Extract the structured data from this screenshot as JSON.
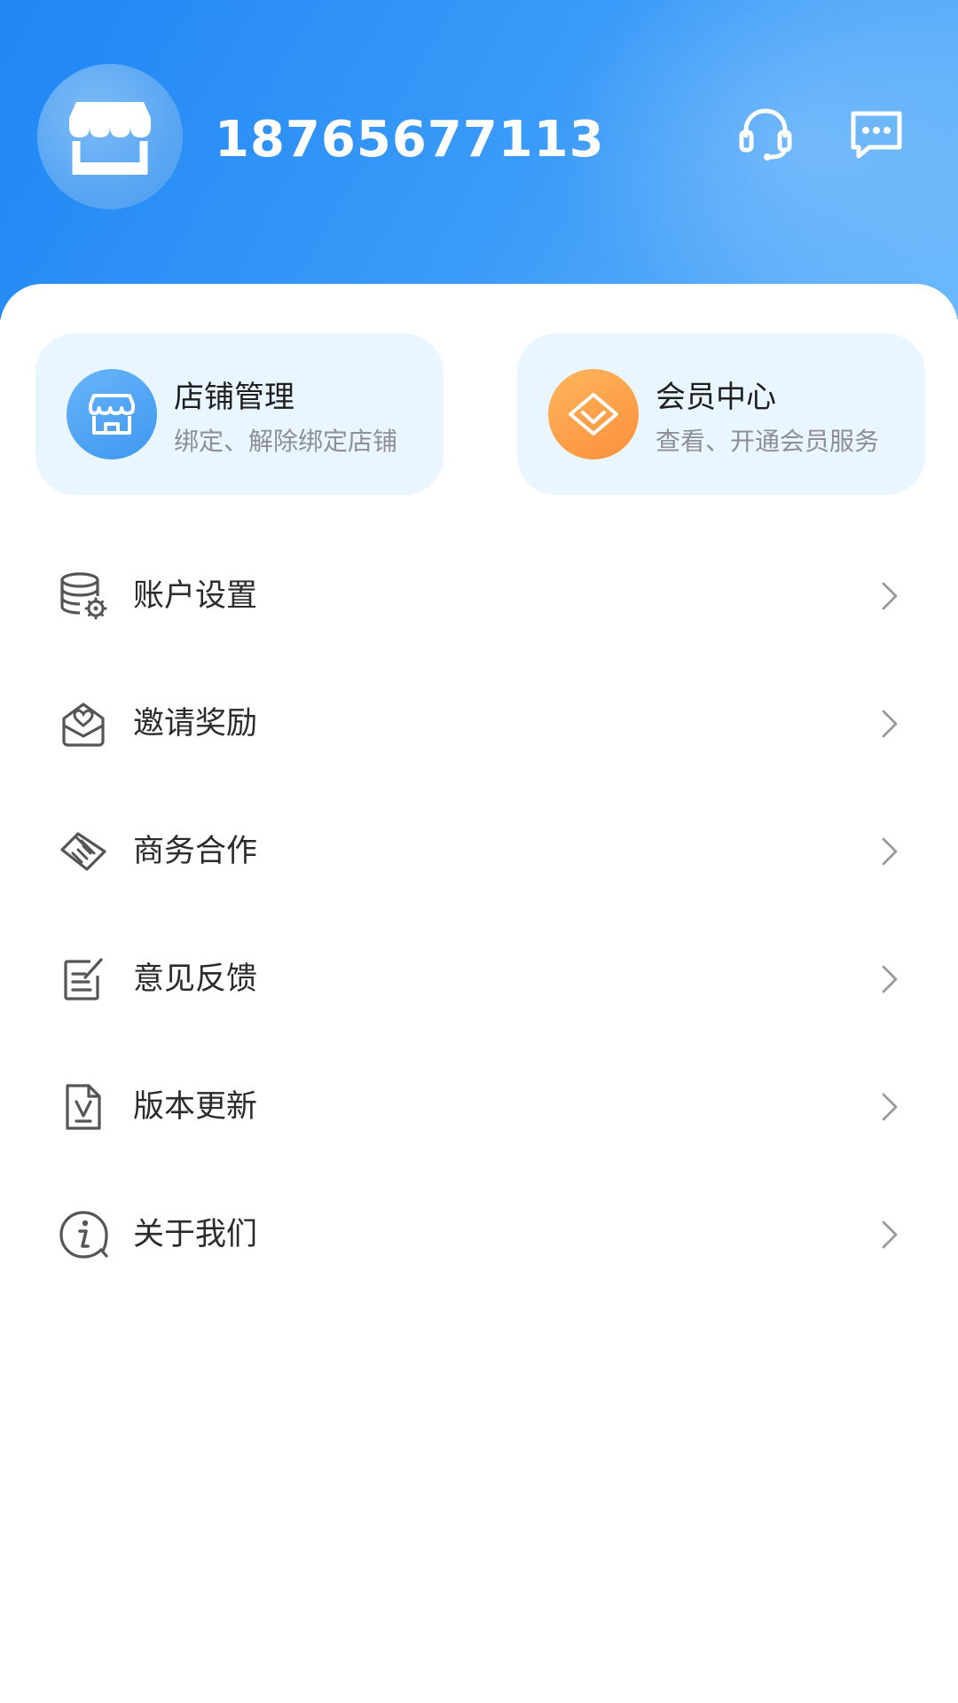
{
  "header": {
    "phone": "18765677113",
    "avatar_icon": "store-icon",
    "service_icon": "headset-icon",
    "message_icon": "chat-bubble-icon",
    "gradient_start": "#1f86f4",
    "gradient_end": "#6bb8fb"
  },
  "cards": [
    {
      "title": "店铺管理",
      "subtitle": "绑定、解除绑定店铺",
      "icon": "store-icon",
      "icon_color": "#4a9ff2"
    },
    {
      "title": "会员中心",
      "subtitle": "查看、开通会员服务",
      "icon": "diamond-icon",
      "icon_color": "#fb9a45"
    }
  ],
  "menu": {
    "items": [
      {
        "label": "账户设置",
        "icon": "database-gear-icon"
      },
      {
        "label": "邀请奖励",
        "icon": "gift-envelope-icon"
      },
      {
        "label": "商务合作",
        "icon": "handshake-icon"
      },
      {
        "label": "意见反馈",
        "icon": "edit-note-icon"
      },
      {
        "label": "版本更新",
        "icon": "version-file-icon"
      },
      {
        "label": "关于我们",
        "icon": "info-icon"
      }
    ]
  },
  "colors": {
    "card_bg": "#eaf6ff",
    "text_primary": "#2b2b2b",
    "text_secondary": "#8d8f93",
    "chevron": "#9a9a9a"
  }
}
